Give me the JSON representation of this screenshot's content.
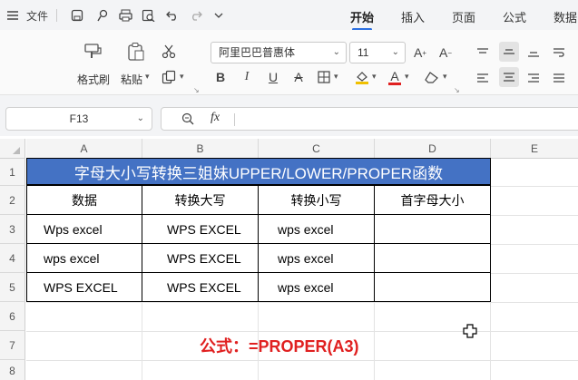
{
  "titlebar": {
    "file_label": "文件",
    "tabs": [
      "开始",
      "插入",
      "页面",
      "公式",
      "数据"
    ],
    "active_tab": "开始"
  },
  "ribbon": {
    "format_painter": "格式刷",
    "paste": "粘贴",
    "font_name": "阿里巴巴普惠体",
    "font_size": "11"
  },
  "formula_bar": {
    "cell_ref": "F13",
    "fx": "fx",
    "content": ""
  },
  "columns": [
    "A",
    "B",
    "C",
    "D",
    "E"
  ],
  "rows": [
    "1",
    "2",
    "3",
    "4",
    "5",
    "6",
    "7",
    "8"
  ],
  "sheet": {
    "title": "字母大小写转换三姐妹UPPER/LOWER/PROPER函数",
    "headers": [
      "数据",
      "转换大写",
      "转换小写",
      "首字母大小"
    ],
    "data": [
      [
        "Wps excel",
        "WPS EXCEL",
        "wps excel",
        ""
      ],
      [
        "wps excel",
        "WPS EXCEL",
        "wps excel",
        ""
      ],
      [
        "WPS EXCEL",
        "WPS EXCEL",
        "wps excel",
        ""
      ]
    ],
    "formula_note": "公式：=PROPER(A3)"
  },
  "colors": {
    "title_fill": "#4472c4",
    "accent": "#2b6fe0",
    "formula_text": "#e02020"
  }
}
